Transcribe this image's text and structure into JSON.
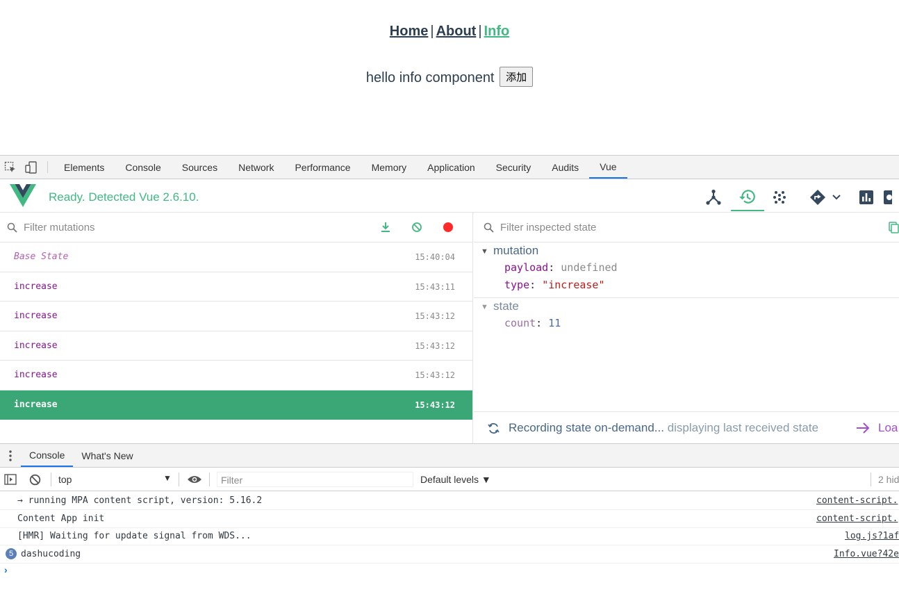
{
  "app": {
    "nav": [
      {
        "label": "Home",
        "active": false
      },
      {
        "label": "About",
        "active": false
      },
      {
        "label": "Info",
        "active": true
      }
    ],
    "nav_separator": "|",
    "hello_text": "hello info component",
    "add_button": "添加"
  },
  "devtools": {
    "tabs": [
      "Elements",
      "Console",
      "Sources",
      "Network",
      "Performance",
      "Memory",
      "Application",
      "Security",
      "Audits",
      "Vue"
    ],
    "active_tab": "Vue"
  },
  "vue": {
    "status": "Ready. Detected Vue 2.6.10.",
    "mutation_filter_placeholder": "Filter mutations",
    "state_filter_placeholder": "Filter inspected state",
    "mutations": [
      {
        "name": "Base State",
        "time": "15:40:04",
        "base": true,
        "selected": false
      },
      {
        "name": "increase",
        "time": "15:43:11",
        "base": false,
        "selected": false
      },
      {
        "name": "increase",
        "time": "15:43:12",
        "base": false,
        "selected": false
      },
      {
        "name": "increase",
        "time": "15:43:12",
        "base": false,
        "selected": false
      },
      {
        "name": "increase",
        "time": "15:43:12",
        "base": false,
        "selected": false
      },
      {
        "name": "increase",
        "time": "15:43:12",
        "base": false,
        "selected": true
      }
    ],
    "inspector": {
      "mutation_title": "mutation",
      "payload_key": "payload",
      "payload_value": "undefined",
      "type_key": "type",
      "type_value": "\"increase\"",
      "state_title": "state",
      "count_key": "count",
      "count_value": "11"
    },
    "recording": {
      "text": "Recording state on-demand...",
      "dim": "displaying last received state",
      "load": "Loa"
    }
  },
  "drawer": {
    "tabs": [
      "Console",
      "What's New"
    ],
    "active_tab": "Console",
    "context": "top",
    "filter_placeholder": "Filter",
    "levels": "Default levels ▼",
    "hidden": "2 hid",
    "logs": [
      {
        "message": "→ running MPA content script, version: 5.16.2",
        "source": "content-script.",
        "badge": ""
      },
      {
        "message": "Content App init",
        "source": "content-script.",
        "badge": ""
      },
      {
        "message": "[HMR] Waiting for update signal from WDS...",
        "source": "log.js?1af",
        "badge": ""
      },
      {
        "message": "dashucoding",
        "source": "Info.vue?42e",
        "badge": "5"
      }
    ]
  },
  "colors": {
    "vue_green": "#42b983",
    "selected_row": "#3ba776",
    "accent_blue": "#1a73e8",
    "mutation_purple": "#881391"
  }
}
